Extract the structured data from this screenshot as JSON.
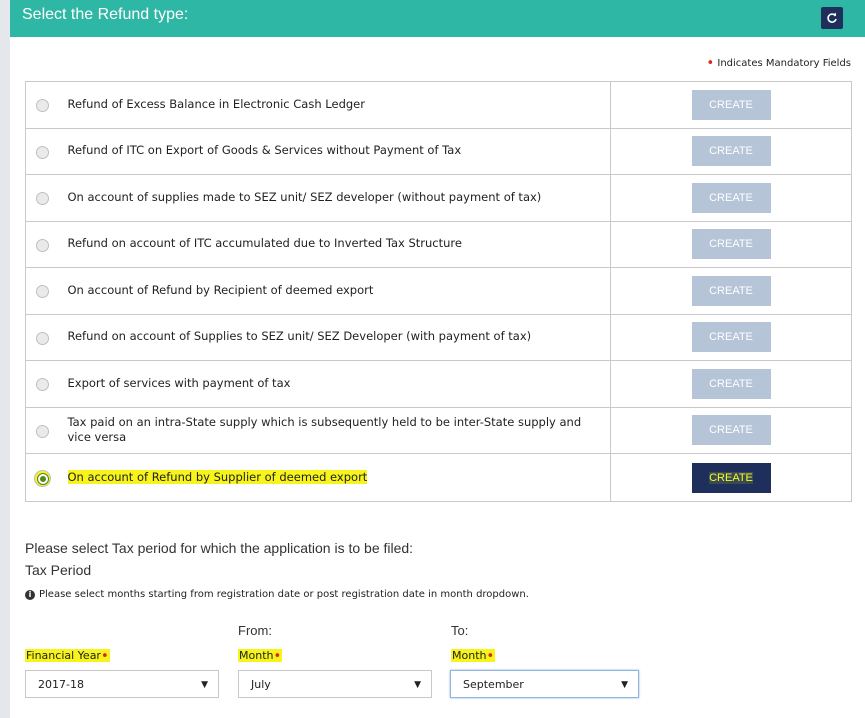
{
  "header": {
    "title": "Select the Refund type:",
    "refresh_icon": "refresh-icon"
  },
  "mandatory_note": "Indicates Mandatory Fields",
  "refund_options": [
    {
      "label": "Refund of Excess Balance in Electronic Cash Ledger",
      "button": "CREATE",
      "selected": false
    },
    {
      "label": "Refund of ITC on Export of Goods & Services without Payment of Tax",
      "button": "CREATE",
      "selected": false
    },
    {
      "label": "On account of supplies made to SEZ unit/ SEZ developer (without payment of tax)",
      "button": "CREATE",
      "selected": false
    },
    {
      "label": "Refund on account of ITC accumulated due to Inverted Tax Structure",
      "button": "CREATE",
      "selected": false
    },
    {
      "label": "On account of Refund by Recipient of deemed export",
      "button": "CREATE",
      "selected": false
    },
    {
      "label": "Refund on account of Supplies to SEZ unit/ SEZ Developer (with payment of tax)",
      "button": "CREATE",
      "selected": false
    },
    {
      "label": "Export of services with payment of tax",
      "button": "CREATE",
      "selected": false
    },
    {
      "label": "Tax paid on an intra-State supply which is subsequently held to be inter-State supply and vice versa",
      "button": "CREATE",
      "selected": false
    },
    {
      "label": "On account of Refund by Supplier of deemed export",
      "button": "CREATE",
      "selected": true
    }
  ],
  "tax_period": {
    "prompt": "Please select Tax period for which the application is to be filed:",
    "heading": "Tax Period",
    "info": "Please select months starting from registration date or post registration date in month dropdown.",
    "from_label": "From:",
    "to_label": "To:",
    "financial_year": {
      "label": "Financial Year",
      "value": "2017-18"
    },
    "from_month": {
      "label": "Month",
      "value": "July"
    },
    "to_month": {
      "label": "Month",
      "value": "September"
    }
  },
  "colors": {
    "header_bg": "#2fb7a5",
    "button_active": "#1f2f5c",
    "button_disabled": "#b6c4d8",
    "highlight": "#f6f41a",
    "required": "#e32222"
  }
}
